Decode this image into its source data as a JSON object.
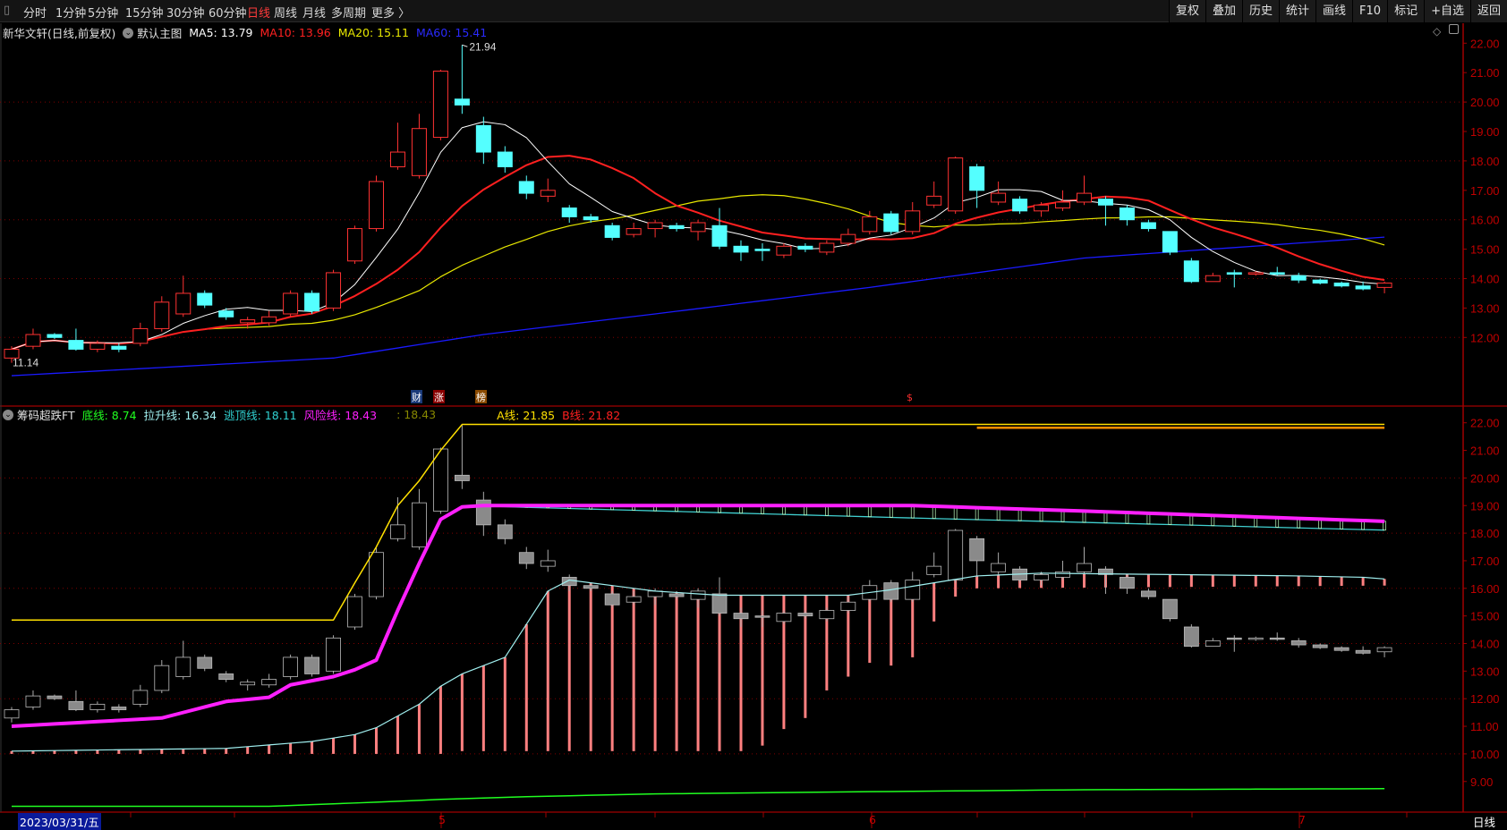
{
  "toolbar": {
    "tabs": [
      "分时",
      "1分钟",
      "5分钟",
      "15分钟",
      "30分钟",
      "60分钟",
      "日线",
      "周线",
      "月线",
      "多周期",
      "更多 〉"
    ],
    "active": "日线",
    "right_buttons": [
      "复权",
      "叠加",
      "历史",
      "统计",
      "画线",
      "F10",
      "标记",
      "+自选",
      "返回"
    ]
  },
  "main_legend": {
    "title": "新华文轩(日线,前复权)",
    "template": "默认主图",
    "ma5": "MA5: 13.79",
    "ma10": "MA10: 13.96",
    "ma20": "MA20: 15.11",
    "ma60": "MA60: 15.41"
  },
  "sub_legend": {
    "title": "筹码超跌FT",
    "bottom": "底线: 8.74",
    "lift": "拉升线: 16.34",
    "escape": "逃顶线: 18.11",
    "risk": "风险线: 18.43",
    "extra": ": 18.43",
    "a": "A线: 21.85",
    "b": "B线: 21.82"
  },
  "colors": {
    "up": "#ff3232",
    "down": "#54ffff",
    "ma5": "#ffffff",
    "ma10": "#ff2020",
    "ma20": "#e8e800",
    "ma60": "#1a1aff",
    "risk": "#ff20ff",
    "escape": "#40d0d0",
    "lift": "#a0f0f0",
    "bottom": "#20ff20",
    "a": "#ffe000",
    "b": "#ff9000",
    "bars": "#ff8080",
    "axis": "#c00000"
  },
  "annotations": {
    "high": "21.94",
    "low": "11.14",
    "markers": [
      "财",
      "涨",
      "榜",
      "$"
    ]
  },
  "axis": {
    "main_ticks": [
      "22.00",
      "21.00",
      "20.00",
      "19.00",
      "18.00",
      "17.00",
      "16.00",
      "15.00",
      "14.00",
      "13.00",
      "12.00"
    ],
    "sub_ticks": [
      "22.00",
      "21.00",
      "20.00",
      "19.00",
      "18.00",
      "17.00",
      "16.00",
      "15.00",
      "14.00",
      "13.00",
      "12.00",
      "11.00",
      "10.00",
      "9.00"
    ],
    "date_cursor": "2023/03/31/五",
    "months": [
      "5",
      "6",
      "7"
    ],
    "period": "日线"
  },
  "chart_data": {
    "type": "candlestick",
    "ohlc_oc_hl": [
      [
        11.3,
        11.6,
        11.7,
        11.14
      ],
      [
        11.7,
        12.1,
        12.3,
        11.6
      ],
      [
        12.1,
        12.0,
        12.15,
        11.95
      ],
      [
        11.9,
        11.6,
        12.3,
        11.55
      ],
      [
        11.6,
        11.8,
        11.9,
        11.5
      ],
      [
        11.7,
        11.6,
        11.8,
        11.5
      ],
      [
        11.8,
        12.3,
        12.5,
        11.7
      ],
      [
        12.3,
        13.2,
        13.4,
        12.2
      ],
      [
        12.8,
        13.5,
        14.1,
        12.7
      ],
      [
        13.5,
        13.1,
        13.6,
        13.0
      ],
      [
        12.9,
        12.7,
        13.0,
        12.6
      ],
      [
        12.5,
        12.6,
        12.7,
        12.3
      ],
      [
        12.5,
        12.7,
        12.9,
        12.4
      ],
      [
        12.8,
        13.5,
        13.6,
        12.7
      ],
      [
        13.5,
        12.9,
        13.6,
        12.8
      ],
      [
        13.0,
        14.2,
        14.3,
        12.9
      ],
      [
        14.6,
        15.7,
        15.8,
        14.5
      ],
      [
        15.7,
        17.3,
        17.5,
        15.6
      ],
      [
        17.8,
        18.3,
        19.3,
        17.7
      ],
      [
        17.5,
        19.1,
        19.6,
        17.4
      ],
      [
        18.8,
        21.05,
        21.1,
        18.7
      ],
      [
        20.1,
        19.9,
        21.94,
        19.6
      ],
      [
        19.2,
        18.3,
        19.5,
        17.9
      ],
      [
        18.3,
        17.8,
        18.5,
        17.6
      ],
      [
        17.3,
        16.9,
        17.5,
        16.7
      ],
      [
        16.8,
        17.0,
        17.4,
        16.6
      ],
      [
        16.4,
        16.1,
        16.5,
        15.9
      ],
      [
        16.1,
        16.0,
        16.2,
        15.9
      ],
      [
        15.8,
        15.4,
        15.9,
        15.3
      ],
      [
        15.5,
        15.7,
        15.9,
        15.4
      ],
      [
        15.7,
        15.9,
        16.0,
        15.4
      ],
      [
        15.8,
        15.7,
        15.9,
        15.6
      ],
      [
        15.6,
        15.9,
        16.0,
        15.3
      ],
      [
        15.8,
        15.1,
        16.4,
        15.0
      ],
      [
        15.1,
        14.9,
        15.3,
        14.6
      ],
      [
        15.0,
        14.95,
        15.2,
        14.6
      ],
      [
        14.8,
        15.1,
        15.2,
        14.7
      ],
      [
        15.1,
        15.0,
        15.2,
        14.9
      ],
      [
        14.9,
        15.2,
        15.3,
        14.8
      ],
      [
        15.2,
        15.5,
        15.7,
        15.1
      ],
      [
        15.6,
        16.1,
        16.3,
        15.5
      ],
      [
        16.2,
        15.6,
        16.3,
        15.5
      ],
      [
        15.6,
        16.3,
        16.6,
        15.5
      ],
      [
        16.5,
        16.8,
        17.3,
        16.4
      ],
      [
        16.3,
        18.1,
        18.15,
        16.2
      ],
      [
        17.8,
        17.0,
        17.9,
        16.4
      ],
      [
        16.6,
        16.9,
        17.3,
        16.5
      ],
      [
        16.7,
        16.3,
        16.8,
        16.2
      ],
      [
        16.3,
        16.5,
        16.6,
        16.1
      ],
      [
        16.4,
        16.6,
        17.0,
        16.3
      ],
      [
        16.6,
        16.9,
        17.5,
        16.5
      ],
      [
        16.7,
        16.5,
        16.8,
        15.8
      ],
      [
        16.4,
        16.0,
        16.5,
        15.8
      ],
      [
        15.9,
        15.7,
        16.0,
        15.6
      ],
      [
        15.6,
        14.9,
        15.6,
        14.8
      ],
      [
        14.6,
        13.9,
        14.7,
        13.85
      ],
      [
        13.9,
        14.1,
        14.2,
        13.9
      ],
      [
        14.2,
        14.15,
        14.3,
        13.7
      ],
      [
        14.15,
        14.2,
        14.25,
        14.1
      ],
      [
        14.2,
        14.15,
        14.4,
        14.1
      ],
      [
        14.1,
        13.95,
        14.2,
        13.85
      ],
      [
        13.95,
        13.85,
        14.0,
        13.8
      ],
      [
        13.85,
        13.75,
        13.9,
        13.7
      ],
      [
        13.75,
        13.65,
        13.9,
        13.6
      ],
      [
        13.7,
        13.85,
        13.9,
        13.5
      ]
    ],
    "ma60_anchors": [
      [
        0,
        10.7
      ],
      [
        15,
        11.3
      ],
      [
        22,
        12.1
      ],
      [
        30,
        12.8
      ],
      [
        40,
        13.7
      ],
      [
        50,
        14.7
      ],
      [
        64,
        15.41
      ]
    ],
    "a_line": [
      [
        0,
        14.85
      ],
      [
        15,
        14.85
      ],
      [
        16,
        16.2
      ],
      [
        17,
        17.5
      ],
      [
        18,
        19.0
      ],
      [
        19,
        19.9
      ],
      [
        20,
        21.0
      ],
      [
        21,
        21.94
      ],
      [
        64,
        21.94
      ]
    ],
    "b_line": [
      [
        45,
        21.82
      ],
      [
        64,
        21.82
      ]
    ],
    "risk_line": [
      [
        0,
        11.0
      ],
      [
        7,
        11.3
      ],
      [
        10,
        11.9
      ],
      [
        12,
        12.05
      ],
      [
        13,
        12.5
      ],
      [
        15,
        12.8
      ],
      [
        16,
        13.05
      ],
      [
        17,
        13.4
      ],
      [
        18,
        15.2
      ],
      [
        19,
        16.9
      ],
      [
        20,
        18.5
      ],
      [
        21,
        18.95
      ],
      [
        22,
        19.0
      ],
      [
        42,
        19.0
      ],
      [
        50,
        18.8
      ],
      [
        64,
        18.43
      ]
    ],
    "escape_line": [
      [
        22,
        18.98
      ],
      [
        42,
        18.55
      ],
      [
        64,
        18.11
      ]
    ],
    "lift_line": [
      [
        0,
        10.1
      ],
      [
        10,
        10.2
      ],
      [
        14,
        10.45
      ],
      [
        16,
        10.7
      ],
      [
        17,
        10.95
      ],
      [
        19,
        11.8
      ],
      [
        20,
        12.45
      ],
      [
        21,
        12.9
      ],
      [
        22,
        13.2
      ],
      [
        23,
        13.5
      ],
      [
        24,
        14.7
      ],
      [
        25,
        15.9
      ],
      [
        26,
        16.3
      ],
      [
        28,
        16.1
      ],
      [
        30,
        15.9
      ],
      [
        33,
        15.75
      ],
      [
        39,
        15.75
      ],
      [
        41,
        15.95
      ],
      [
        43,
        16.2
      ],
      [
        45,
        16.45
      ],
      [
        48,
        16.55
      ],
      [
        60,
        16.45
      ],
      [
        63,
        16.4
      ],
      [
        64,
        16.34
      ]
    ],
    "bar_bottom": [
      [
        0,
        10.0
      ],
      [
        20,
        10.0
      ],
      [
        21,
        10.1
      ],
      [
        34,
        10.1
      ],
      [
        35,
        10.3
      ],
      [
        36,
        10.9
      ],
      [
        37,
        11.3
      ],
      [
        38,
        12.3
      ],
      [
        39,
        12.8
      ],
      [
        40,
        13.3
      ],
      [
        41,
        13.2
      ],
      [
        42,
        13.5
      ],
      [
        43,
        14.8
      ],
      [
        44,
        15.7
      ],
      [
        45,
        16.0
      ],
      [
        64,
        16.1
      ]
    ],
    "bottom_line": [
      [
        0,
        8.1
      ],
      [
        12,
        8.1
      ],
      [
        17,
        8.25
      ],
      [
        20,
        8.35
      ],
      [
        24,
        8.45
      ],
      [
        30,
        8.55
      ],
      [
        40,
        8.63
      ],
      [
        50,
        8.7
      ],
      [
        64,
        8.74
      ]
    ],
    "main_ylim": [
      12,
      22
    ],
    "sub_ylim": [
      9,
      22
    ]
  }
}
